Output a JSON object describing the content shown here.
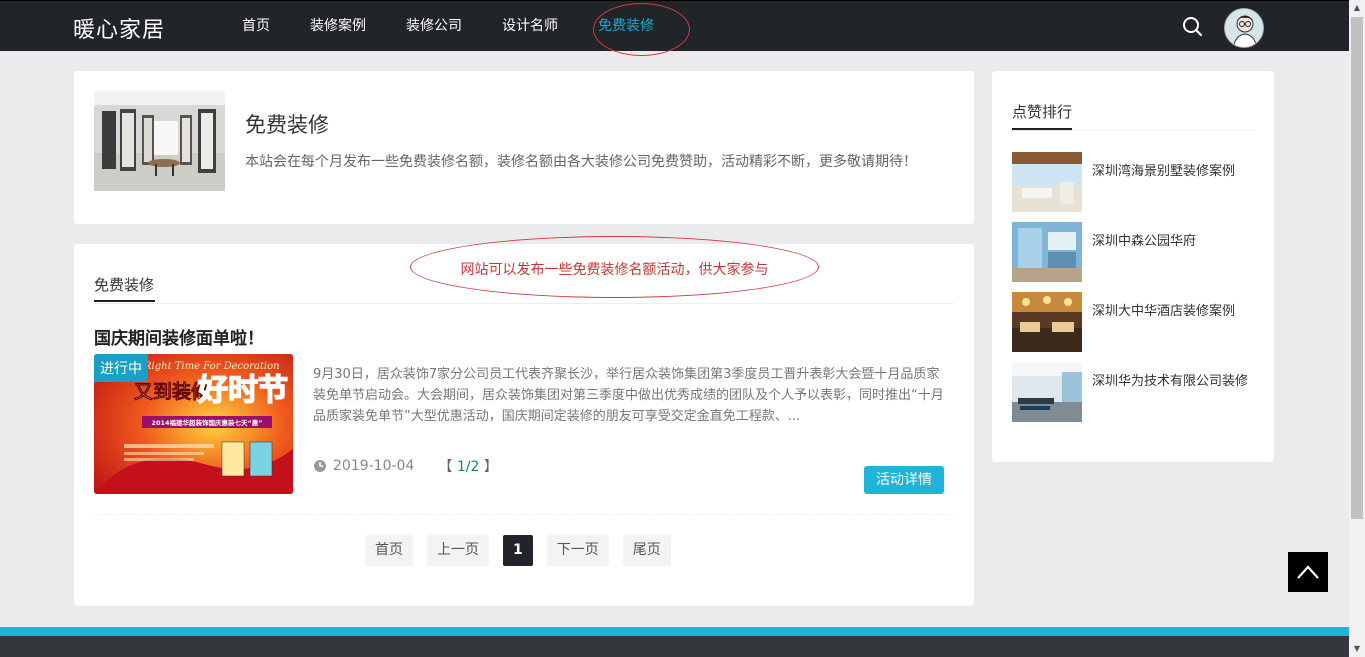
{
  "header": {
    "logo": "暖心家居",
    "nav": [
      {
        "label": "首页"
      },
      {
        "label": "装修案例"
      },
      {
        "label": "装修公司"
      },
      {
        "label": "设计名师"
      },
      {
        "label": "免费装修"
      }
    ],
    "active_index": 4,
    "accent_color": "#1eaacb",
    "search_icon": "search-icon",
    "avatar_icon": "avatar"
  },
  "intro": {
    "title": "免费装修",
    "description": "本站会在每个月发布一些免费装修名额，装修名额由各大装修公司免费赞助，活动精彩不断，更多敬请期待！"
  },
  "list": {
    "tab_label": "免费装修",
    "annotation": "网站可以发布一些免费装修名额活动，供大家参与",
    "post": {
      "title": "国庆期间装修面单啦！",
      "badge": "进行中",
      "thumb_text_top": "Right Time For Decoration",
      "thumb_text_cn": "又到装修",
      "thumb_text_big": "好时节",
      "thumb_banner": "2014福建华超装饰国庆惠装七天“惠”",
      "excerpt": "9月30日，居众装饰7家分公司员工代表齐聚长沙，举行居众装饰集团第3季度员工晋升表彰大会暨十月品质家装免单节启动会。大会期间，居众装饰集团对第三季度中做出优秀成绩的团队及个人予以表彰，同时推出“十月品质家装免单节”大型优惠活动，国庆期间定装修的朋友可享受交定金直免工程款、...",
      "date": "2019-10-04",
      "pages_open": "【",
      "pages_value": "1/2",
      "pages_close": "】",
      "detail_button": "活动详情"
    },
    "pager": {
      "first": "首页",
      "prev": "上一页",
      "current": "1",
      "next": "下一页",
      "last": "尾页"
    }
  },
  "sidebar": {
    "title": "点赞排行",
    "items": [
      {
        "label": "深圳湾海景别墅装修案例"
      },
      {
        "label": "深圳中森公园华府"
      },
      {
        "label": "深圳大中华酒店装修案例"
      },
      {
        "label": "深圳华为技术有限公司装修"
      }
    ]
  },
  "colors": {
    "header_bg": "#212428",
    "footer_accent": "#1eb5d6",
    "annotation_red": "#d23c3c"
  }
}
